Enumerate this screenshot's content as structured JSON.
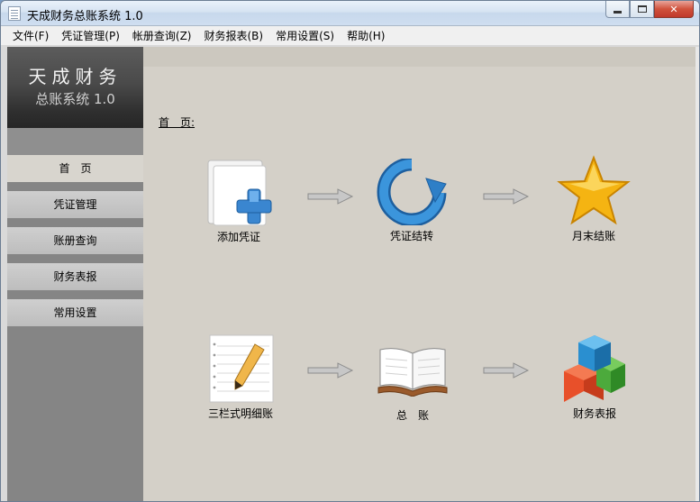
{
  "window": {
    "title": "天成财务总账系统 1.0"
  },
  "menu": [
    {
      "label": "文件(F)"
    },
    {
      "label": "凭证管理(P)"
    },
    {
      "label": "帐册查询(Z)"
    },
    {
      "label": "财务报表(B)"
    },
    {
      "label": "常用设置(S)"
    },
    {
      "label": "帮助(H)"
    }
  ],
  "logo": {
    "title": "天成财务",
    "subtitle": "总账系统 1.0"
  },
  "sidebar": {
    "items": [
      {
        "label": "首　页",
        "active": true
      },
      {
        "label": "凭证管理"
      },
      {
        "label": "账册查询"
      },
      {
        "label": "财务表报"
      },
      {
        "label": "常用设置"
      }
    ]
  },
  "main": {
    "page_label": "首　页:",
    "row1": [
      {
        "label": "添加凭证",
        "icon": "add-document-icon"
      },
      {
        "label": "凭证结转",
        "icon": "refresh-arrow-icon"
      },
      {
        "label": "月末结账",
        "icon": "star-icon"
      }
    ],
    "row2": [
      {
        "label": "三栏式明细账",
        "icon": "notepad-pencil-icon"
      },
      {
        "label": "总　账",
        "icon": "open-book-icon"
      },
      {
        "label": "财务表报",
        "icon": "colored-cubes-icon"
      }
    ]
  },
  "colors": {
    "accent_blue": "#2e7fc7",
    "star": "#f5b412",
    "sidebar": "#858585"
  }
}
